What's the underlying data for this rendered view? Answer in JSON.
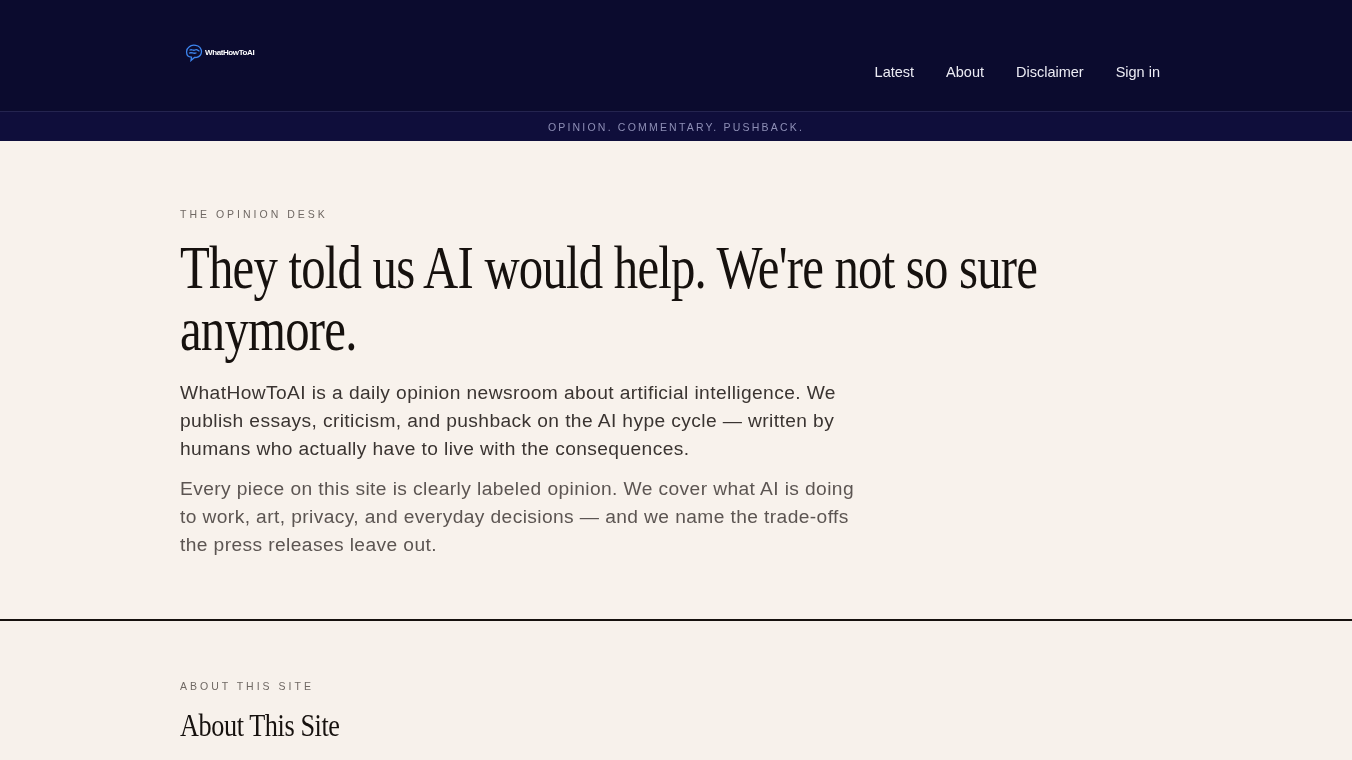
{
  "header": {
    "logo": {
      "wordmark": "WhatHowToAI"
    },
    "nav": [
      "Latest",
      "About",
      "Disclaimer",
      "Sign in"
    ]
  },
  "tagline_bar": {
    "text": "OPINION. COMMENTARY. PUSHBACK."
  },
  "hero": {
    "eyebrow": "THE OPINION DESK",
    "headline": "They told us AI would help. We're not so sure anymore.",
    "paragraphs": [
      "WhatHowToAI is a daily opinion newsroom about artificial intelligence. We publish essays, criticism, and pushback on the AI hype cycle — written by humans who actually have to live with the consequences.",
      "Every piece on this site is clearly labeled opinion. We cover what AI is doing to work, art, privacy, and everyday decisions — and we name the trade-offs the press releases leave out."
    ]
  },
  "about": {
    "eyebrow": "ABOUT THIS SITE",
    "heading": "About This Site"
  }
}
